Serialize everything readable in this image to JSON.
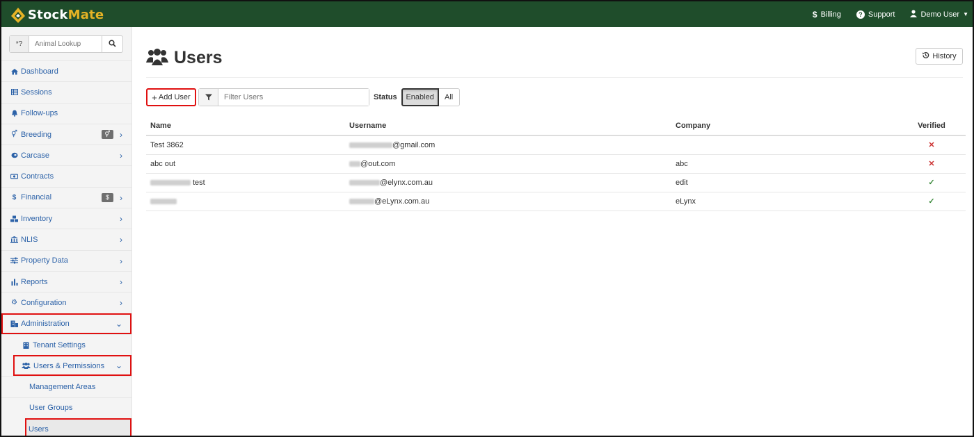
{
  "brand": {
    "part1": "Stock",
    "part2": "Mate"
  },
  "topnav": {
    "billing": "Billing",
    "support": "Support",
    "user": "Demo User"
  },
  "sidebar": {
    "lookup": {
      "prefix": "*?",
      "placeholder": "Animal Lookup"
    },
    "items": [
      {
        "label": "Dashboard"
      },
      {
        "label": "Sessions"
      },
      {
        "label": "Follow-ups"
      },
      {
        "label": "Breeding"
      },
      {
        "label": "Carcase"
      },
      {
        "label": "Contracts"
      },
      {
        "label": "Financial",
        "badge": "$"
      },
      {
        "label": "Inventory"
      },
      {
        "label": "NLIS"
      },
      {
        "label": "Property Data"
      },
      {
        "label": "Reports"
      },
      {
        "label": "Configuration"
      },
      {
        "label": "Administration"
      },
      {
        "label": "Tenant Settings"
      },
      {
        "label": "Users & Permissions"
      },
      {
        "label": "Management Areas"
      },
      {
        "label": "User Groups"
      },
      {
        "label": "Users"
      }
    ]
  },
  "main": {
    "title": "Users",
    "history": "History",
    "add_user": "Add User",
    "filter_placeholder": "Filter Users",
    "status_label": "Status",
    "status_options": [
      "Enabled",
      "All"
    ],
    "columns": [
      "Name",
      "Username",
      "Company",
      "Verified"
    ],
    "rows": [
      {
        "name": "Test 3862",
        "username": "@gmail.com",
        "company": "",
        "verified": "✕"
      },
      {
        "name": "abc out",
        "username": "@out.com",
        "company": "abc",
        "verified": "✕"
      },
      {
        "name": "test",
        "username": "@elynx.com.au",
        "company": "edit",
        "verified": "✓"
      },
      {
        "name": "",
        "username": "@eLynx.com.au",
        "company": "eLynx",
        "verified": "✓"
      }
    ]
  }
}
